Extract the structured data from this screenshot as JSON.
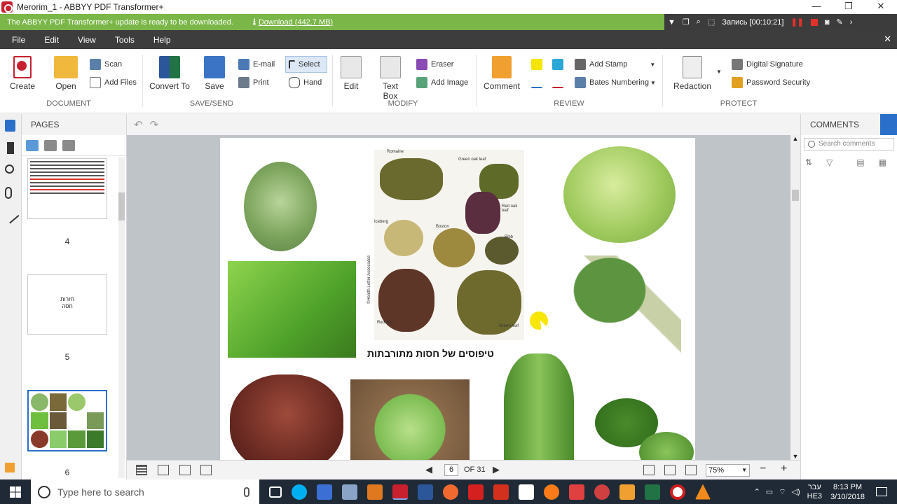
{
  "window": {
    "title": "Merorim_1 - ABBYY PDF Transformer+",
    "buttons": [
      "—",
      "❐",
      "✕"
    ]
  },
  "notification": {
    "message": "The ABBYY PDF Transformer+ update is ready to be downloaded.",
    "download_label": "Download (442.7 MB)"
  },
  "recorder": {
    "label": "Запись [00:10:21]"
  },
  "menu": [
    "File",
    "Edit",
    "View",
    "Tools",
    "Help"
  ],
  "ribbon": {
    "document": {
      "label": "DOCUMENT",
      "create": "Create",
      "open": "Open",
      "scan": "Scan",
      "add_files": "Add Files"
    },
    "save_send": {
      "label": "SAVE/SEND",
      "convert_to": "Convert To",
      "save": "Save",
      "email": "E-mail",
      "print": "Print"
    },
    "select": "Select",
    "hand": "Hand",
    "modify": {
      "label": "MODIFY",
      "edit": "Edit",
      "text_box": "Text Box",
      "eraser": "Eraser",
      "add_image": "Add Image"
    },
    "review": {
      "label": "REVIEW",
      "comment": "Comment",
      "add_stamp": "Add Stamp",
      "bates_numbering": "Bates Numbering"
    },
    "protect": {
      "label": "PROTECT",
      "redaction": "Redaction",
      "digital_signature": "Digital Signature",
      "password_security": "Password Security"
    }
  },
  "pages_panel": {
    "title": "PAGES",
    "pages": [
      "4",
      "5",
      "6"
    ],
    "page5_text": [
      "חזרות",
      "חסה"
    ]
  },
  "document": {
    "caption": "טיפוסים של חסות מתורבתות",
    "lettuce_labels": [
      "Romaine",
      "Green oak leaf",
      "Red oak leaf",
      "Iceberg",
      "Boston",
      "Bibb",
      "Red leaf",
      "Green leaf",
      "©Health Letter Associates"
    ]
  },
  "bottombar": {
    "current_page": "6",
    "of_pages": "OF 31",
    "zoom": "75%"
  },
  "comments_panel": {
    "title": "COMMENTS",
    "search_placeholder": "Search comments"
  },
  "taskbar": {
    "search_placeholder": "Type here to search",
    "lang": "עבר",
    "lang2": "HE3",
    "time": "8:13 PM",
    "date": "3/10/2018"
  },
  "colors": {
    "notify_green": "#7ab648",
    "menubar": "#3d3d3d",
    "taskbar": "#1f2a36"
  }
}
